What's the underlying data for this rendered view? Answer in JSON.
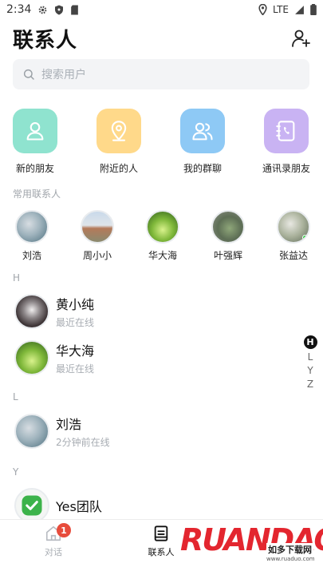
{
  "status_bar": {
    "time": "2:34",
    "network": "LTE"
  },
  "header": {
    "title": "联系人"
  },
  "search": {
    "placeholder": "搜索用户"
  },
  "quick_actions": [
    {
      "label": "新的朋友",
      "icon": "person-icon",
      "color": "#8fe3cf"
    },
    {
      "label": "附近的人",
      "icon": "location-pin-icon",
      "color": "#ffd98a"
    },
    {
      "label": "我的群聊",
      "icon": "group-icon",
      "color": "#8ec9f5"
    },
    {
      "label": "通讯录朋友",
      "icon": "phonebook-icon",
      "color": "#c9b3f3"
    }
  ],
  "frequent_section": {
    "label": "常用联系人"
  },
  "frequent_contacts": [
    {
      "name": "刘浩"
    },
    {
      "name": "周小小"
    },
    {
      "name": "华大海"
    },
    {
      "name": "叶强辉"
    },
    {
      "name": "张益达",
      "online": true
    }
  ],
  "contact_groups": [
    {
      "letter": "H",
      "contacts": [
        {
          "name": "黄小纯",
          "status": "最近在线"
        },
        {
          "name": "华大海",
          "status": "最近在线"
        }
      ]
    },
    {
      "letter": "L",
      "contacts": [
        {
          "name": "刘浩",
          "status": "2分钟前在线"
        }
      ]
    },
    {
      "letter": "Y",
      "contacts": [
        {
          "name": "Yes团队",
          "status": ""
        }
      ]
    }
  ],
  "alpha_index": {
    "active": "H",
    "letters": [
      "L",
      "Y",
      "Z"
    ]
  },
  "bottom_nav": {
    "tabs": [
      {
        "label": "对话",
        "badge": "1",
        "active": false
      },
      {
        "label": "联系人",
        "active": true
      }
    ]
  },
  "watermark": {
    "brand": "RUANDAO",
    "cn": "如多下载网",
    "url": "www.ruaduo.com"
  },
  "colors": {
    "accent": "#111111",
    "badge": "#e74c3c",
    "online": "#2ecc40"
  }
}
